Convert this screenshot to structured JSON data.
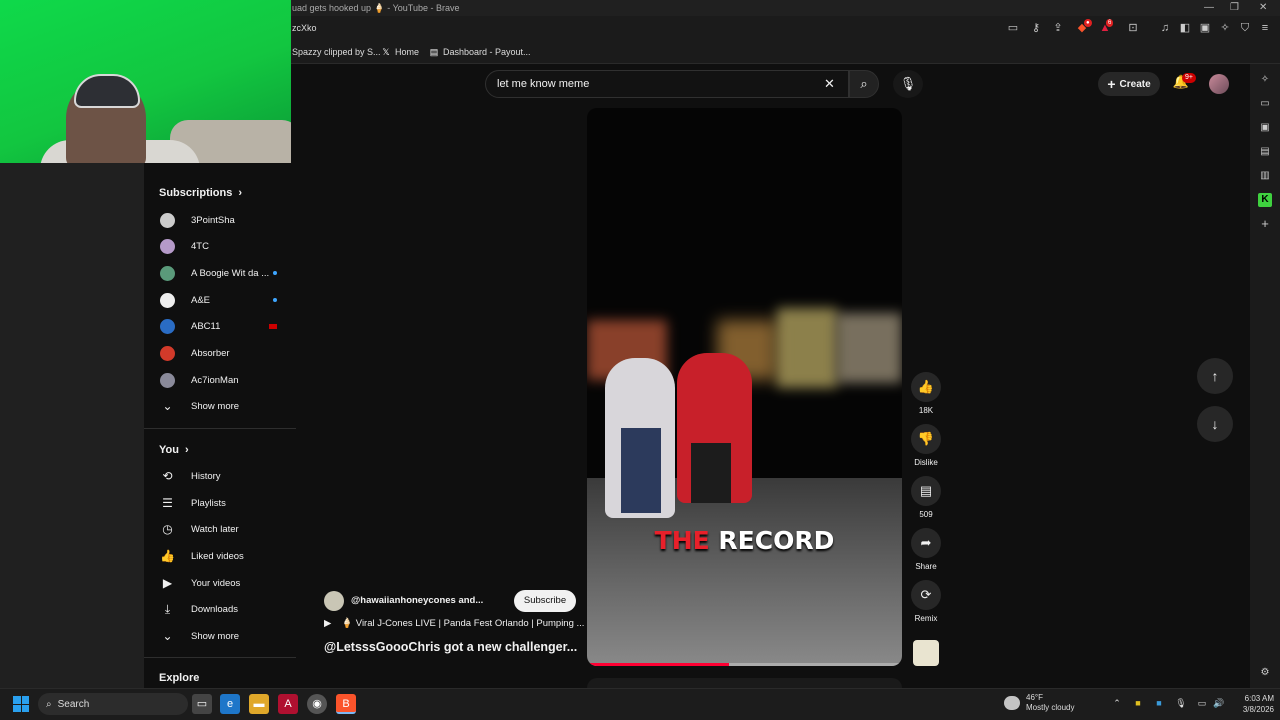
{
  "browser": {
    "window_title": "uad gets hooked up 🍦 - YouTube - Brave",
    "url_fragment": "zcXko",
    "bookmarks": [
      {
        "label": "Spazzy clipped by S...",
        "icon": "bookmark-icon"
      },
      {
        "label": "Home",
        "icon": "x-logo-icon"
      },
      {
        "label": "Dashboard - Payout...",
        "icon": "dashboard-icon"
      }
    ],
    "extension_badge": "6",
    "notification_badge": "1"
  },
  "youtube": {
    "search": {
      "value": "let me know meme"
    },
    "create_label": "Create",
    "notifications_badge": "9+"
  },
  "sidebar": {
    "subscriptions_header": "Subscriptions",
    "subscriptions": [
      {
        "label": "3PointSha",
        "marker": "none",
        "color": "#cccccc"
      },
      {
        "label": "4TC",
        "marker": "none",
        "color": "#b59ac9"
      },
      {
        "label": "A Boogie Wit da ...",
        "marker": "dot",
        "color": "#5a9a7a"
      },
      {
        "label": "A&E",
        "marker": "dot",
        "color": "#eeeeee"
      },
      {
        "label": "ABC11",
        "marker": "live",
        "color": "#2a6cc4"
      },
      {
        "label": "Absorber",
        "marker": "none",
        "color": "#d23a2a"
      },
      {
        "label": "Ac7ionMan",
        "marker": "none",
        "color": "#8a8a9a"
      }
    ],
    "subscriptions_more": "Show more",
    "you_header": "You",
    "you_items": [
      {
        "label": "History",
        "icon": "history-icon",
        "glyph": "⟲"
      },
      {
        "label": "Playlists",
        "icon": "playlists-icon",
        "glyph": "☰"
      },
      {
        "label": "Watch later",
        "icon": "watch-later-icon",
        "glyph": "◷"
      },
      {
        "label": "Liked videos",
        "icon": "thumbs-up-icon",
        "glyph": "👍"
      },
      {
        "label": "Your videos",
        "icon": "your-videos-icon",
        "glyph": "▶"
      },
      {
        "label": "Downloads",
        "icon": "download-icon",
        "glyph": "⤓"
      }
    ],
    "you_more": "Show more",
    "explore_header": "Explore"
  },
  "short": {
    "caption_red": "THE",
    "caption_white": "RECORD",
    "progress": 0.45,
    "channel": "@hawaiianhoneycones and...",
    "subscribe_label": "Subscribe",
    "song": "🍦 Viral J-Cones LIVE | Panda Fest Orlando | Pumping ...",
    "title": "@LetsssGoooChris got a new challenger...",
    "actions": [
      {
        "name": "like-button",
        "icon": "thumbs-up-icon",
        "glyph": "👍",
        "label": "18K"
      },
      {
        "name": "dislike-button",
        "icon": "thumbs-down-icon",
        "glyph": "👎",
        "label": "Dislike"
      },
      {
        "name": "comments-button",
        "icon": "comment-icon",
        "glyph": "▤",
        "label": "509"
      },
      {
        "name": "share-button",
        "icon": "share-icon",
        "glyph": "➦",
        "label": "Share"
      },
      {
        "name": "remix-button",
        "icon": "remix-icon",
        "glyph": "⟳",
        "label": "Remix"
      }
    ]
  },
  "taskbar": {
    "search_label": "Search",
    "weather_temp": "46°F",
    "weather_desc": "Mostly cloudy",
    "time": "6:03 AM",
    "date": "3/8/2026"
  },
  "colors": {
    "accent_red": "#ff0033",
    "background": "#0f0f0f",
    "windows_blue": "#2aa0ee"
  }
}
